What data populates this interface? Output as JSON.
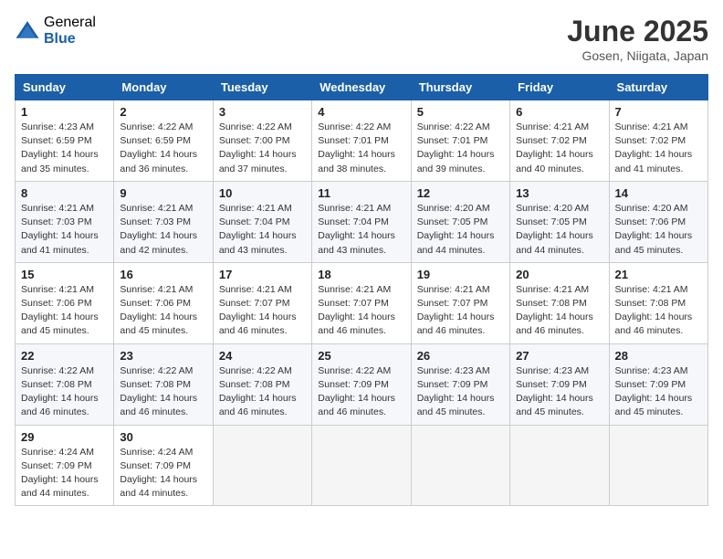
{
  "logo": {
    "general": "General",
    "blue": "Blue"
  },
  "title": "June 2025",
  "location": "Gosen, Niigata, Japan",
  "days_of_week": [
    "Sunday",
    "Monday",
    "Tuesday",
    "Wednesday",
    "Thursday",
    "Friday",
    "Saturday"
  ],
  "weeks": [
    [
      {
        "day": "1",
        "sunrise": "4:23 AM",
        "sunset": "6:59 PM",
        "daylight": "14 hours and 35 minutes."
      },
      {
        "day": "2",
        "sunrise": "4:22 AM",
        "sunset": "6:59 PM",
        "daylight": "14 hours and 36 minutes."
      },
      {
        "day": "3",
        "sunrise": "4:22 AM",
        "sunset": "7:00 PM",
        "daylight": "14 hours and 37 minutes."
      },
      {
        "day": "4",
        "sunrise": "4:22 AM",
        "sunset": "7:01 PM",
        "daylight": "14 hours and 38 minutes."
      },
      {
        "day": "5",
        "sunrise": "4:22 AM",
        "sunset": "7:01 PM",
        "daylight": "14 hours and 39 minutes."
      },
      {
        "day": "6",
        "sunrise": "4:21 AM",
        "sunset": "7:02 PM",
        "daylight": "14 hours and 40 minutes."
      },
      {
        "day": "7",
        "sunrise": "4:21 AM",
        "sunset": "7:02 PM",
        "daylight": "14 hours and 41 minutes."
      }
    ],
    [
      {
        "day": "8",
        "sunrise": "4:21 AM",
        "sunset": "7:03 PM",
        "daylight": "14 hours and 41 minutes."
      },
      {
        "day": "9",
        "sunrise": "4:21 AM",
        "sunset": "7:03 PM",
        "daylight": "14 hours and 42 minutes."
      },
      {
        "day": "10",
        "sunrise": "4:21 AM",
        "sunset": "7:04 PM",
        "daylight": "14 hours and 43 minutes."
      },
      {
        "day": "11",
        "sunrise": "4:21 AM",
        "sunset": "7:04 PM",
        "daylight": "14 hours and 43 minutes."
      },
      {
        "day": "12",
        "sunrise": "4:20 AM",
        "sunset": "7:05 PM",
        "daylight": "14 hours and 44 minutes."
      },
      {
        "day": "13",
        "sunrise": "4:20 AM",
        "sunset": "7:05 PM",
        "daylight": "14 hours and 44 minutes."
      },
      {
        "day": "14",
        "sunrise": "4:20 AM",
        "sunset": "7:06 PM",
        "daylight": "14 hours and 45 minutes."
      }
    ],
    [
      {
        "day": "15",
        "sunrise": "4:21 AM",
        "sunset": "7:06 PM",
        "daylight": "14 hours and 45 minutes."
      },
      {
        "day": "16",
        "sunrise": "4:21 AM",
        "sunset": "7:06 PM",
        "daylight": "14 hours and 45 minutes."
      },
      {
        "day": "17",
        "sunrise": "4:21 AM",
        "sunset": "7:07 PM",
        "daylight": "14 hours and 46 minutes."
      },
      {
        "day": "18",
        "sunrise": "4:21 AM",
        "sunset": "7:07 PM",
        "daylight": "14 hours and 46 minutes."
      },
      {
        "day": "19",
        "sunrise": "4:21 AM",
        "sunset": "7:07 PM",
        "daylight": "14 hours and 46 minutes."
      },
      {
        "day": "20",
        "sunrise": "4:21 AM",
        "sunset": "7:08 PM",
        "daylight": "14 hours and 46 minutes."
      },
      {
        "day": "21",
        "sunrise": "4:21 AM",
        "sunset": "7:08 PM",
        "daylight": "14 hours and 46 minutes."
      }
    ],
    [
      {
        "day": "22",
        "sunrise": "4:22 AM",
        "sunset": "7:08 PM",
        "daylight": "14 hours and 46 minutes."
      },
      {
        "day": "23",
        "sunrise": "4:22 AM",
        "sunset": "7:08 PM",
        "daylight": "14 hours and 46 minutes."
      },
      {
        "day": "24",
        "sunrise": "4:22 AM",
        "sunset": "7:08 PM",
        "daylight": "14 hours and 46 minutes."
      },
      {
        "day": "25",
        "sunrise": "4:22 AM",
        "sunset": "7:09 PM",
        "daylight": "14 hours and 46 minutes."
      },
      {
        "day": "26",
        "sunrise": "4:23 AM",
        "sunset": "7:09 PM",
        "daylight": "14 hours and 45 minutes."
      },
      {
        "day": "27",
        "sunrise": "4:23 AM",
        "sunset": "7:09 PM",
        "daylight": "14 hours and 45 minutes."
      },
      {
        "day": "28",
        "sunrise": "4:23 AM",
        "sunset": "7:09 PM",
        "daylight": "14 hours and 45 minutes."
      }
    ],
    [
      {
        "day": "29",
        "sunrise": "4:24 AM",
        "sunset": "7:09 PM",
        "daylight": "14 hours and 44 minutes."
      },
      {
        "day": "30",
        "sunrise": "4:24 AM",
        "sunset": "7:09 PM",
        "daylight": "14 hours and 44 minutes."
      },
      null,
      null,
      null,
      null,
      null
    ]
  ],
  "labels": {
    "sunrise": "Sunrise:",
    "sunset": "Sunset:",
    "daylight": "Daylight:"
  }
}
